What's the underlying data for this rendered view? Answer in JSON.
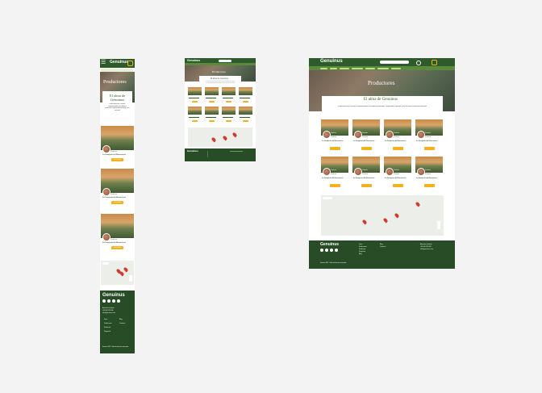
{
  "brand": "Genuinus",
  "hero_title": "Productores",
  "section_title": "El alma de Genuinus",
  "intro_text_mobile": "Productores por Corazón, comprometidos con elaborar productos, respetando el paisaje y los recursos",
  "intro_text_desktop": "Productores por Corazón, comprometidos con elaborar productos, respetando el paisaje y los recursos a nuestros alimentos",
  "card": {
    "producer_small_label": "Productor",
    "subtitle": "Productos",
    "title": "La Granjería del Monasterio",
    "button_label": "Ver tienda"
  },
  "footer": {
    "brand": "Genuinus",
    "social": [
      "facebook-icon",
      "twitter-icon",
      "instagram-icon",
      "youtube-icon"
    ],
    "contact_heading": "Atención al cliente",
    "phone": "+34 900 123 456",
    "email": "info@genuinus.com",
    "links_left": [
      "Inicio",
      "Productores",
      "Productos",
      "Preguntas",
      "Blog"
    ],
    "links_right": [
      "Blog",
      "Contacto"
    ],
    "copyright": "Genuinus 2021 · Todos los derechos reservados"
  },
  "colors": {
    "primary": "#2f5a2c",
    "accent": "#f2b21c",
    "nav_highlight": "#bfe08a"
  }
}
